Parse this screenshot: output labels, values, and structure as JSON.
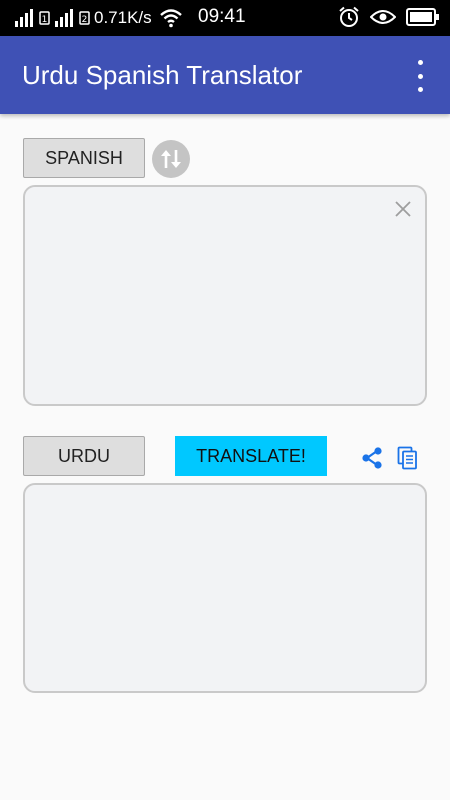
{
  "status_bar": {
    "network_speed": "0.71K/s",
    "time": "09:41",
    "sim1_label": "1",
    "sim2_label": "2"
  },
  "app_bar": {
    "title": "Urdu Spanish Translator"
  },
  "source": {
    "language_label": "SPANISH",
    "input_text": ""
  },
  "target": {
    "language_label": "URDU",
    "output_text": ""
  },
  "actions": {
    "translate_label": "TRANSLATE!"
  },
  "colors": {
    "app_bar": "#3f51b5",
    "translate_button": "#00c8ff",
    "icon_accent": "#1a73e8"
  }
}
